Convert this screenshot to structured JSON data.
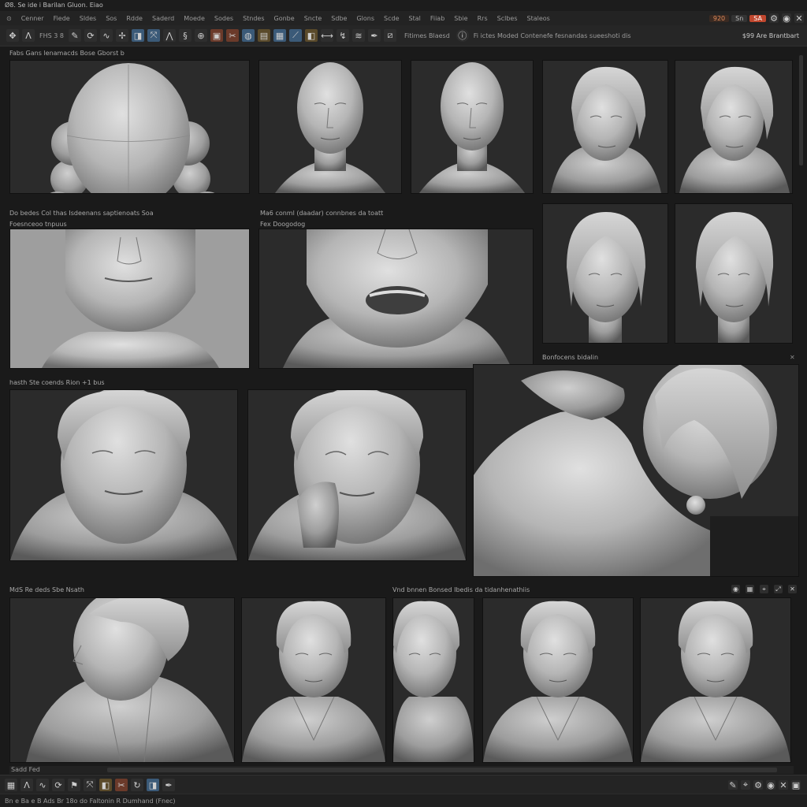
{
  "titlebar": {
    "text": "Ø8.  Se ide i Barilan  Gluon.  Eiao"
  },
  "menu": [
    "Cenner",
    "Fiede",
    "Sldes",
    "Sos",
    "Rdde",
    "Saderd",
    "Moede",
    "Sodes",
    "Stndes",
    "Gonbe",
    "Sncte",
    "Sdbe",
    "Glons",
    "Scde",
    "Stal",
    "Fiiab",
    "Sbie",
    "Rrs",
    "Sclbes",
    "Staleos"
  ],
  "topright": {
    "value": "920",
    "button": "Sn",
    "tab": "SA"
  },
  "toolbar": {
    "text1": "FHS 3 8",
    "info_text": "Fitimes Blaesd",
    "info_text2": "Fi ictes Moded Contenefe fesnandas sueeshoti dis",
    "right_label": "$99 Are Brantbart"
  },
  "panels": [
    {
      "label": "Fabs Gans lenamacds Bose Gborst b",
      "views": [
        "sphere-base",
        "head-bald-1",
        "head-bald-2",
        "head-hair-1",
        "head-hair-2"
      ]
    },
    {
      "label": "Do bedes Col thas Isdeenans saptienoats Soa",
      "sublabel": "Foesnceoo tnpuus",
      "views": [
        "face-closeup-light"
      ]
    },
    {
      "label": "Ma6 conml (daadar) connbnes da toatt",
      "sublabel": "Fex Doogodog",
      "views": [
        "mouth-open-closeup"
      ]
    },
    {
      "label": "",
      "views": [
        "head-hair-front-1",
        "head-hair-front-2"
      ]
    },
    {
      "label": "Bonfocens bidalin",
      "views": [
        "shoulder-detail"
      ]
    },
    {
      "label": "hasth Ste coends Rion +1 bus",
      "views": [
        "expression-1",
        "expression-2"
      ]
    },
    {
      "label": "MdS Re deds Sbe Nsath",
      "views": [
        "profile-jacket"
      ]
    },
    {
      "label": "Vnd bnnen Bonsed Ibedis da tidanhenathiis",
      "views": [
        "bust-1",
        "bust-2",
        "bust-3",
        "bust-4"
      ]
    }
  ],
  "bottombar": {
    "text": "Sadd  Fed  "
  },
  "statusbar": {
    "text": "Bn e  Ba e B Ads  Br 18o  do  Faltonin  R  Dumhand (Fnec)"
  }
}
